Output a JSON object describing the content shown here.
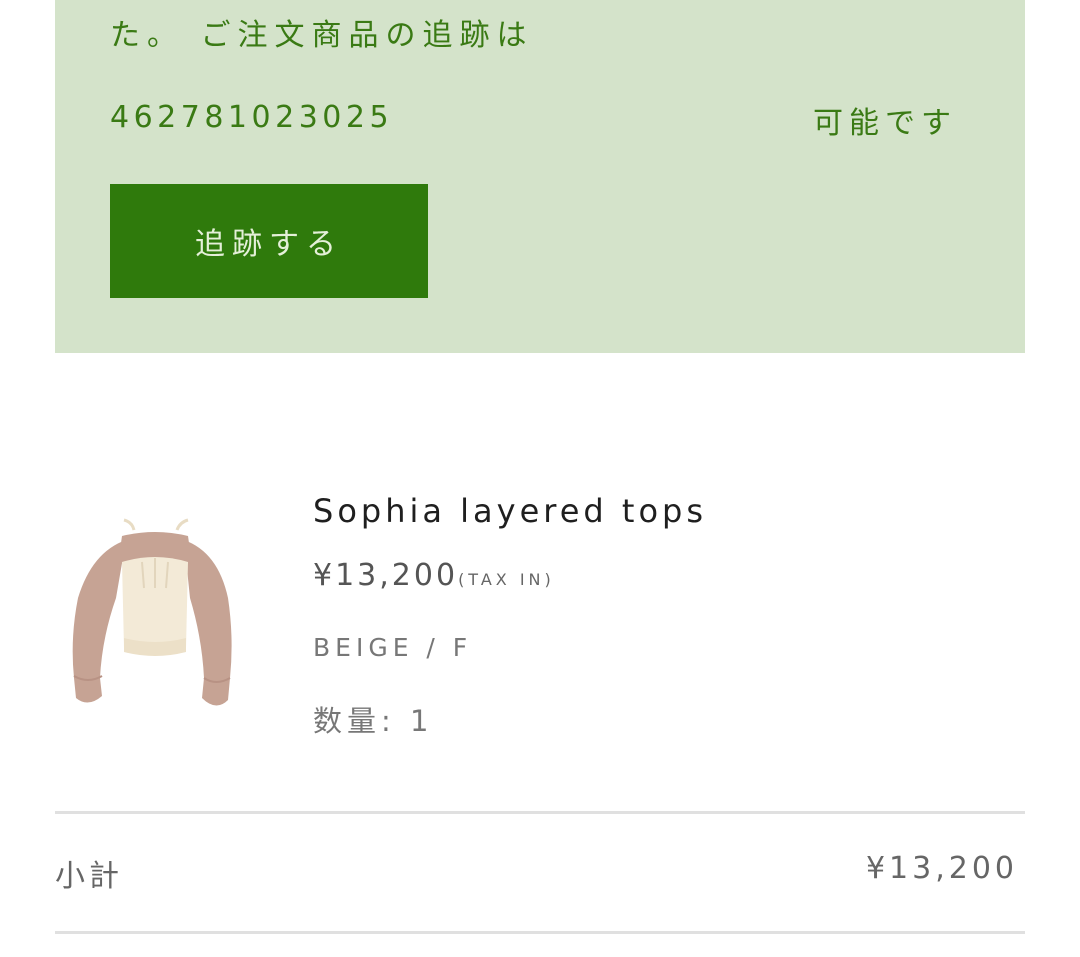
{
  "notice": {
    "line1": "た。 ご注文商品の追跡は",
    "tracking_number": "462781023025",
    "line2_right": "可能です",
    "track_button_label": "追跡する",
    "background_color": "#d4e3ca",
    "text_color": "#3a7a14",
    "button_color": "#2f7a0c"
  },
  "product": {
    "image_icon": "sweater-product-image",
    "name": "Sophia layered tops",
    "price": "¥13,200",
    "tax_note": "(TAX IN)",
    "variant": "BEIGE / F",
    "quantity": "数量: 1"
  },
  "summary": {
    "subtotal_label": "小計",
    "subtotal_value": "¥13,200"
  }
}
